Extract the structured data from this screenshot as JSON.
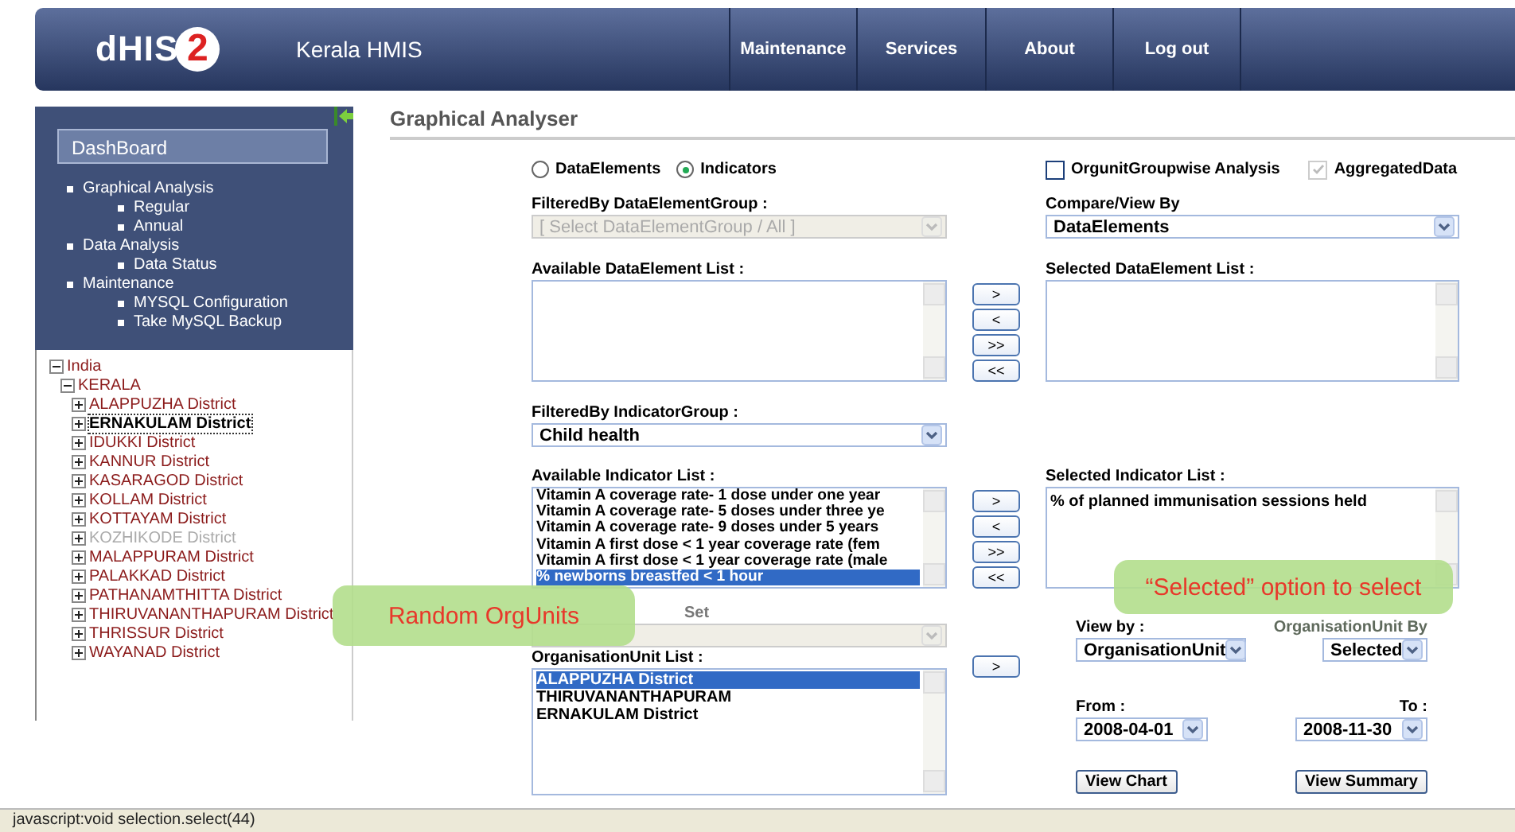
{
  "header": {
    "logo_text": "dHIS",
    "logo_number": "2",
    "app_name": "Kerala HMIS",
    "nav": [
      "Maintenance",
      "Services",
      "About",
      "Log out"
    ]
  },
  "sidebar": {
    "title": "DashBoard",
    "menu": [
      {
        "label": "Graphical Analysis",
        "children": [
          {
            "label": "Regular"
          },
          {
            "label": "Annual"
          }
        ]
      },
      {
        "label": "Data Analysis",
        "children": [
          {
            "label": "Data Status"
          }
        ]
      },
      {
        "label": "Maintenance",
        "children": [
          {
            "label": "MYSQL Configuration"
          },
          {
            "label": "Take MySQL Backup"
          }
        ]
      }
    ],
    "tree": [
      {
        "label": "India",
        "expanded": true,
        "selected": false,
        "disabled": false,
        "children": [
          {
            "label": "KERALA",
            "expanded": true,
            "selected": false,
            "disabled": false,
            "children": [
              {
                "label": "ALAPPUZHA District",
                "expanded": false,
                "selected": false,
                "disabled": false
              },
              {
                "label": "ERNAKULAM District",
                "expanded": false,
                "selected": true,
                "disabled": false
              },
              {
                "label": "IDUKKI District",
                "expanded": false,
                "selected": false,
                "disabled": false
              },
              {
                "label": "KANNUR District",
                "expanded": false,
                "selected": false,
                "disabled": false
              },
              {
                "label": "KASARAGOD District",
                "expanded": false,
                "selected": false,
                "disabled": false
              },
              {
                "label": "KOLLAM District",
                "expanded": false,
                "selected": false,
                "disabled": false
              },
              {
                "label": "KOTTAYAM District",
                "expanded": false,
                "selected": false,
                "disabled": false
              },
              {
                "label": "KOZHIKODE District",
                "expanded": false,
                "selected": false,
                "disabled": true
              },
              {
                "label": "MALAPPURAM District",
                "expanded": false,
                "selected": false,
                "disabled": false
              },
              {
                "label": "PALAKKAD District",
                "expanded": false,
                "selected": false,
                "disabled": false
              },
              {
                "label": "PATHANAMTHITTA District",
                "expanded": false,
                "selected": false,
                "disabled": false
              },
              {
                "label": "THIRUVANANTHAPURAM District",
                "expanded": false,
                "selected": false,
                "disabled": false
              },
              {
                "label": "THRISSUR District",
                "expanded": false,
                "selected": false,
                "disabled": false
              },
              {
                "label": "WAYANAD District",
                "expanded": false,
                "selected": false,
                "disabled": false
              }
            ]
          }
        ]
      }
    ]
  },
  "page_title": "Graphical Analyser",
  "form": {
    "radios": [
      {
        "label": "DataElements",
        "selected": false
      },
      {
        "label": "Indicators",
        "selected": true
      }
    ],
    "checkboxes": [
      {
        "label": "OrgunitGroupwise Analysis",
        "checked": false,
        "disabled": false
      },
      {
        "label": "AggregatedData",
        "checked": true,
        "disabled": true
      }
    ],
    "data_element_group": {
      "label": "FilteredBy DataElementGroup :",
      "value": "[ Select DataElementGroup / All ]",
      "disabled": true
    },
    "compare_by": {
      "label": "Compare/View By",
      "value": "DataElements"
    },
    "available_data_elements": {
      "label": "Available DataElement List :"
    },
    "selected_data_elements": {
      "label": "Selected DataElement List :"
    },
    "move_buttons": [
      ">",
      "<",
      ">>",
      "<<"
    ],
    "indicator_group": {
      "label": "FilteredBy IndicatorGroup :",
      "value": "Child health"
    },
    "available_indicators": {
      "label": "Available Indicator List :",
      "items": [
        {
          "label": "Vitamin A coverage rate- 1 dose under one year",
          "selected": false
        },
        {
          "label": "Vitamin A coverage rate- 5 doses under three ye",
          "selected": false
        },
        {
          "label": "Vitamin A coverage rate- 9 doses under 5 years",
          "selected": false
        },
        {
          "label": "Vitamin A first dose < 1 year coverage rate (fem",
          "selected": false
        },
        {
          "label": "Vitamin A first dose < 1 year coverage rate (male",
          "selected": false
        },
        {
          "label": "% newborns breastfed < 1 hour",
          "selected": true
        }
      ]
    },
    "selected_indicators": {
      "label": "Selected Indicator List :",
      "items": [
        {
          "label": "% of planned immunisation sessions held",
          "selected": false
        }
      ]
    },
    "orgunit_group_set": {
      "label": "Set",
      "disabled": true
    },
    "orgunit_list": {
      "label": "OrganisationUnit List :",
      "items": [
        {
          "label": "ALAPPUZHA District",
          "selected": true
        },
        {
          "label": "THIRUVANANTHAPURAM",
          "selected": false
        },
        {
          "label": "ERNAKULAM District",
          "selected": false
        }
      ]
    },
    "orgunit_button": ">",
    "view_by": {
      "label": "View by :",
      "value": "OrganisationUnit"
    },
    "orgunit_by": {
      "label": "OrganisationUnit By",
      "value": "Selected"
    },
    "from": {
      "label": "From :",
      "value": "2008-04-01"
    },
    "to": {
      "label": "To :",
      "value": "2008-11-30"
    },
    "actions": [
      "View Chart",
      "View Summary"
    ]
  },
  "callouts": [
    "Random OrgUnits",
    "“Selected” option to select"
  ],
  "status_bar": "javascript:void selection.select(44)"
}
